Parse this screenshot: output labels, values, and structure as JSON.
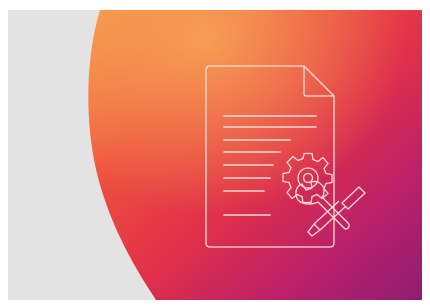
{
  "illustration": {
    "kind": "document-settings-banner",
    "background_color": "#e3e3e3",
    "gradient_colors": [
      "#f59a4a",
      "#ee4f3e",
      "#e0304a",
      "#b81f6b",
      "#8f1e73"
    ],
    "line_color": "#f8dcd2",
    "icons": [
      "document-icon",
      "gear-icon",
      "wrench-icon",
      "screwdriver-icon"
    ]
  }
}
